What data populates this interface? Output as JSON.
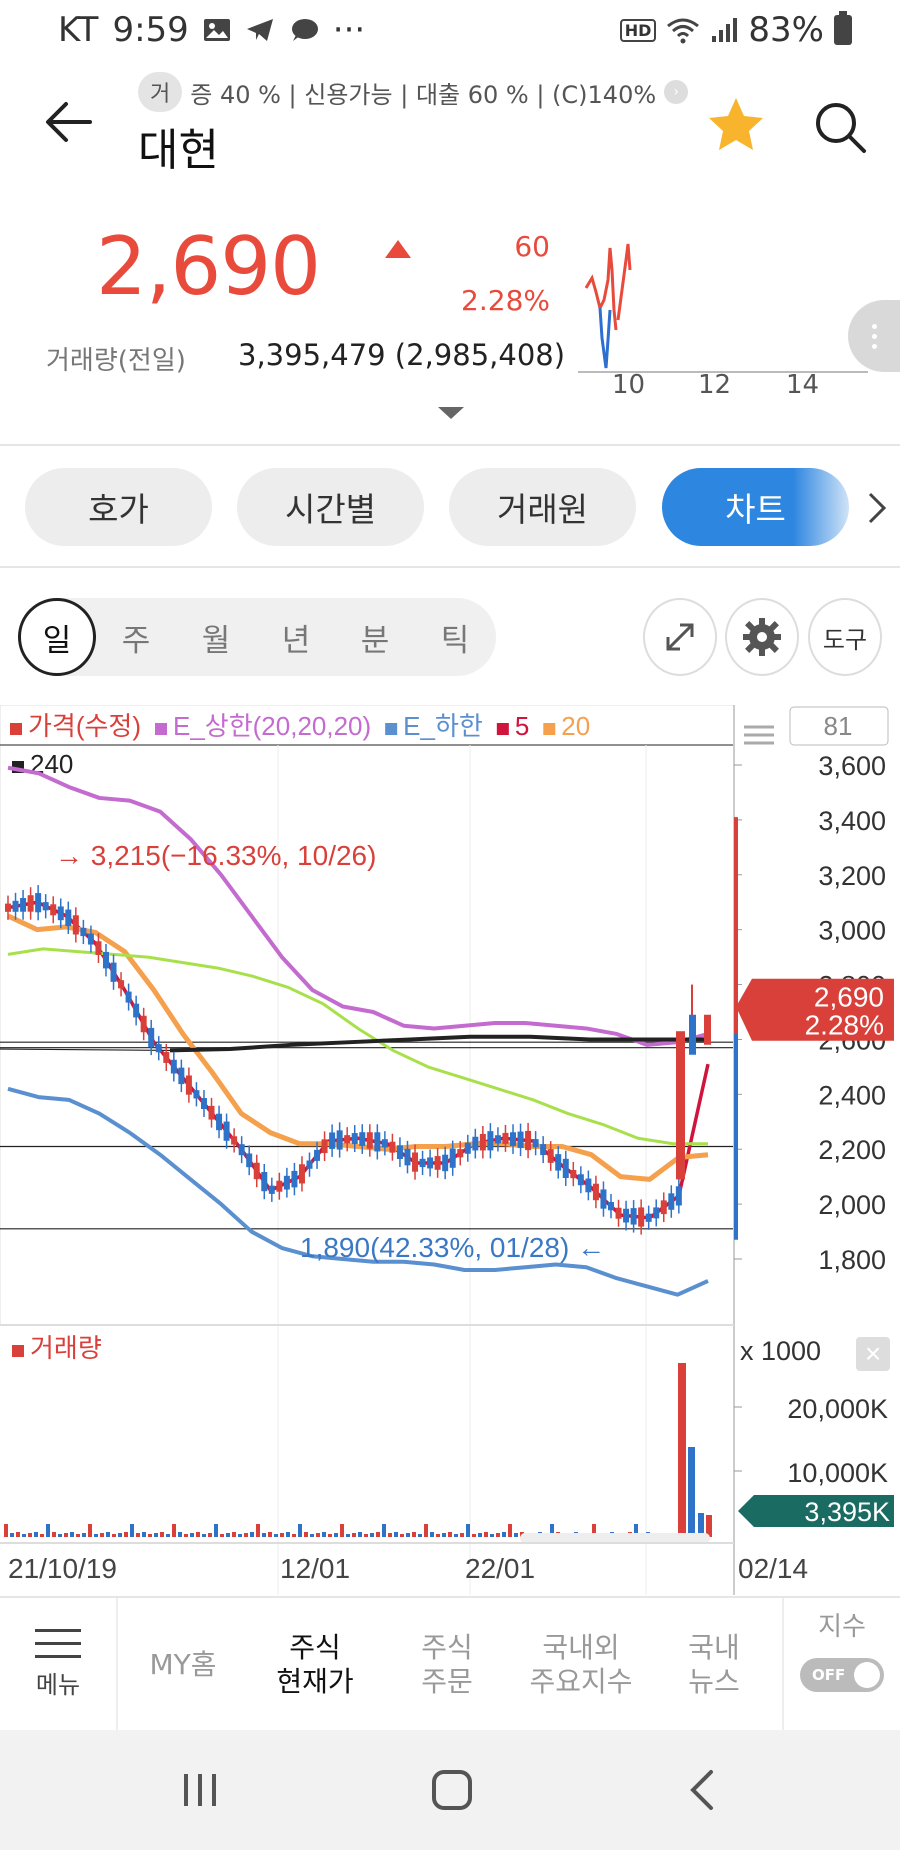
{
  "status_bar": {
    "carrier": "KT",
    "time": "9:59",
    "more": "···",
    "hd": "HD",
    "battery": "83%"
  },
  "header": {
    "tag_badge": "거",
    "tags_text": "증 40 % | 신용가능 | 대출 60 % | (C)140%",
    "stock_name": "대현"
  },
  "quote": {
    "price": "2,690",
    "change": "60",
    "change_pct": "2.28%",
    "volume_label": "거래량(전일)",
    "volume_value": "3,395,479 (2,985,408)",
    "mini_chart_labels": [
      "10",
      "12",
      "14"
    ]
  },
  "tabs": [
    {
      "label": "호가"
    },
    {
      "label": "시간별"
    },
    {
      "label": "거래원"
    },
    {
      "label": "차트"
    }
  ],
  "period": [
    "일",
    "주",
    "월",
    "년",
    "분",
    "틱"
  ],
  "tools": {
    "draw_label": "도구"
  },
  "chart_data": {
    "type": "line",
    "legend": [
      {
        "name": "가격(수정)",
        "color": "#d9403a"
      },
      {
        "name": "E_상한(20,20,20)",
        "color": "#c46bd0"
      },
      {
        "name": "E_하한",
        "color": "#5a8fd0"
      },
      {
        "name": "5",
        "color": "#d0143c"
      },
      {
        "name": "20",
        "color": "#f5a04c"
      },
      {
        "name": "240",
        "color": "#222222"
      }
    ],
    "ylim": [
      1700,
      3700
    ],
    "y_ticks": [
      "3,600",
      "3,400",
      "3,200",
      "3,000",
      "2,800",
      "2,600",
      "2,400",
      "2,200",
      "2,000",
      "1,800"
    ],
    "y_values": [
      3600,
      3400,
      3200,
      3000,
      2800,
      2600,
      2400,
      2200,
      2000,
      1800
    ],
    "x_labels": [
      "21/10/19",
      "12/01",
      "22/01",
      "02/14"
    ],
    "top_right_box": "81",
    "current_price_label": "2,690",
    "current_pct_label": "2.28%",
    "high_annotation": "→ 3,215(−16.33%, 10/26)",
    "low_annotation": "1,890(42.33%, 01/28)  ←",
    "series": [
      {
        "name": "E_상한",
        "values": [
          3590,
          3570,
          3520,
          3480,
          3470,
          3430,
          3330,
          3200,
          3050,
          2900,
          2780,
          2720,
          2700,
          2650,
          2640,
          2650,
          2660,
          2660,
          2650,
          2640,
          2620,
          2580,
          2590,
          2620
        ]
      },
      {
        "name": "E_하한",
        "values": [
          2420,
          2390,
          2380,
          2330,
          2260,
          2180,
          2090,
          2000,
          1900,
          1840,
          1810,
          1800,
          1790,
          1790,
          1780,
          1760,
          1760,
          1770,
          1780,
          1770,
          1730,
          1700,
          1670,
          1720
        ]
      },
      {
        "name": "5",
        "values": [
          3080,
          3100,
          3050,
          2950,
          2780,
          2590,
          2460,
          2330,
          2200,
          2050,
          2100,
          2230,
          2240,
          2220,
          2150,
          2150,
          2220,
          2240,
          2230,
          2140,
          2060,
          1960,
          1950,
          2030,
          2510
        ]
      },
      {
        "name": "20",
        "values": [
          3050,
          3000,
          3010,
          2990,
          2920,
          2780,
          2620,
          2480,
          2330,
          2260,
          2220,
          2220,
          2210,
          2200,
          2210,
          2210,
          2220,
          2220,
          2210,
          2210,
          2180,
          2100,
          2090,
          2170,
          2180
        ]
      },
      {
        "name": "green",
        "values": [
          2910,
          2930,
          2920,
          2910,
          2900,
          2880,
          2860,
          2830,
          2790,
          2730,
          2640,
          2560,
          2500,
          2460,
          2420,
          2380,
          2330,
          2290,
          2240,
          2220,
          2220
        ]
      },
      {
        "name": "240",
        "values": [
          2560,
          2565,
          2580,
          2590,
          2600,
          2610,
          2610,
          2600,
          2600,
          2600
        ]
      }
    ],
    "volume_label": "거래량",
    "volume_unit": "x 1000",
    "volume_ticks": [
      "20,000K",
      "10,000K"
    ],
    "volume_current": "3,395K"
  },
  "bottom_nav": [
    {
      "label": "메뉴"
    },
    {
      "label": "MY홈"
    },
    {
      "label": "주식\n현재가"
    },
    {
      "label": "주식\n주문"
    },
    {
      "label": "국내외\n주요지수"
    },
    {
      "label": "국내\n뉴스"
    },
    {
      "label": "지수"
    }
  ],
  "toggle_label": "OFF",
  "colors": {
    "up": "#e84a3c",
    "accent": "#2d86e0",
    "volume_tag": "#1a6b61"
  }
}
